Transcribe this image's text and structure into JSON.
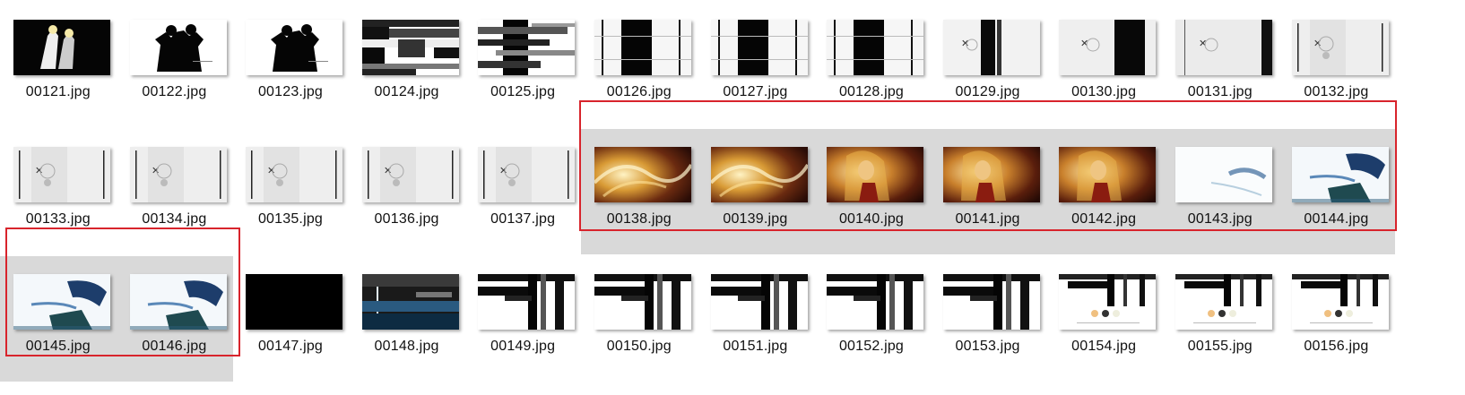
{
  "files": [
    {
      "name": "00121.jpg",
      "selected": false,
      "icon": "image-thumbnail",
      "kind": "dark-figures"
    },
    {
      "name": "00122.jpg",
      "selected": false,
      "icon": "image-thumbnail",
      "kind": "silhouette"
    },
    {
      "name": "00123.jpg",
      "selected": false,
      "icon": "image-thumbnail",
      "kind": "silhouette"
    },
    {
      "name": "00124.jpg",
      "selected": false,
      "icon": "image-thumbnail",
      "kind": "glitch-dark"
    },
    {
      "name": "00125.jpg",
      "selected": false,
      "icon": "image-thumbnail",
      "kind": "glitch-stripes"
    },
    {
      "name": "00126.jpg",
      "selected": false,
      "icon": "image-thumbnail",
      "kind": "wide-black-bar"
    },
    {
      "name": "00127.jpg",
      "selected": false,
      "icon": "image-thumbnail",
      "kind": "wide-black-bar"
    },
    {
      "name": "00128.jpg",
      "selected": false,
      "icon": "image-thumbnail",
      "kind": "wide-black-bar"
    },
    {
      "name": "00129.jpg",
      "selected": false,
      "icon": "image-thumbnail",
      "kind": "gray-logo-bar"
    },
    {
      "name": "00130.jpg",
      "selected": false,
      "icon": "image-thumbnail",
      "kind": "gray-logo-rightbar"
    },
    {
      "name": "00131.jpg",
      "selected": false,
      "icon": "image-thumbnail",
      "kind": "gray-logo-edge"
    },
    {
      "name": "00132.jpg",
      "selected": false,
      "icon": "image-thumbnail",
      "kind": "gray-logo"
    },
    {
      "name": "00133.jpg",
      "selected": false,
      "icon": "image-thumbnail",
      "kind": "gray-logo"
    },
    {
      "name": "00134.jpg",
      "selected": false,
      "icon": "image-thumbnail",
      "kind": "gray-logo"
    },
    {
      "name": "00135.jpg",
      "selected": false,
      "icon": "image-thumbnail",
      "kind": "gray-logo"
    },
    {
      "name": "00136.jpg",
      "selected": false,
      "icon": "image-thumbnail",
      "kind": "gray-logo"
    },
    {
      "name": "00137.jpg",
      "selected": false,
      "icon": "image-thumbnail",
      "kind": "gray-logo"
    },
    {
      "name": "00138.jpg",
      "selected": true,
      "icon": "image-thumbnail",
      "kind": "golden-swirl"
    },
    {
      "name": "00139.jpg",
      "selected": true,
      "icon": "image-thumbnail",
      "kind": "golden-swirl"
    },
    {
      "name": "00140.jpg",
      "selected": true,
      "icon": "image-thumbnail",
      "kind": "golden-girl"
    },
    {
      "name": "00141.jpg",
      "selected": true,
      "icon": "image-thumbnail",
      "kind": "golden-girl"
    },
    {
      "name": "00142.jpg",
      "selected": true,
      "icon": "image-thumbnail",
      "kind": "golden-girl"
    },
    {
      "name": "00143.jpg",
      "selected": true,
      "icon": "image-thumbnail",
      "kind": "white-blue-faint"
    },
    {
      "name": "00144.jpg",
      "selected": true,
      "icon": "image-thumbnail",
      "kind": "white-blue"
    },
    {
      "name": "00145.jpg",
      "selected": true,
      "icon": "image-thumbnail",
      "kind": "white-blue"
    },
    {
      "name": "00146.jpg",
      "selected": true,
      "icon": "image-thumbnail",
      "kind": "white-blue"
    },
    {
      "name": "00147.jpg",
      "selected": false,
      "icon": "image-thumbnail",
      "kind": "black"
    },
    {
      "name": "00148.jpg",
      "selected": false,
      "icon": "image-thumbnail",
      "kind": "dark-blue-glitch"
    },
    {
      "name": "00149.jpg",
      "selected": false,
      "icon": "image-thumbnail",
      "kind": "cross-glitch"
    },
    {
      "name": "00150.jpg",
      "selected": false,
      "icon": "image-thumbnail",
      "kind": "cross-glitch"
    },
    {
      "name": "00151.jpg",
      "selected": false,
      "icon": "image-thumbnail",
      "kind": "cross-glitch"
    },
    {
      "name": "00152.jpg",
      "selected": false,
      "icon": "image-thumbnail",
      "kind": "cross-glitch"
    },
    {
      "name": "00153.jpg",
      "selected": false,
      "icon": "image-thumbnail",
      "kind": "cross-glitch"
    },
    {
      "name": "00154.jpg",
      "selected": false,
      "icon": "image-thumbnail",
      "kind": "cross-glitch-faces"
    },
    {
      "name": "00155.jpg",
      "selected": false,
      "icon": "image-thumbnail",
      "kind": "cross-glitch-faces"
    },
    {
      "name": "00156.jpg",
      "selected": false,
      "icon": "image-thumbnail",
      "kind": "cross-glitch-faces"
    }
  ],
  "colors": {
    "selection_bg": "#d9d9d9",
    "selection_border": "#d8242c",
    "label_text": "#111111"
  }
}
